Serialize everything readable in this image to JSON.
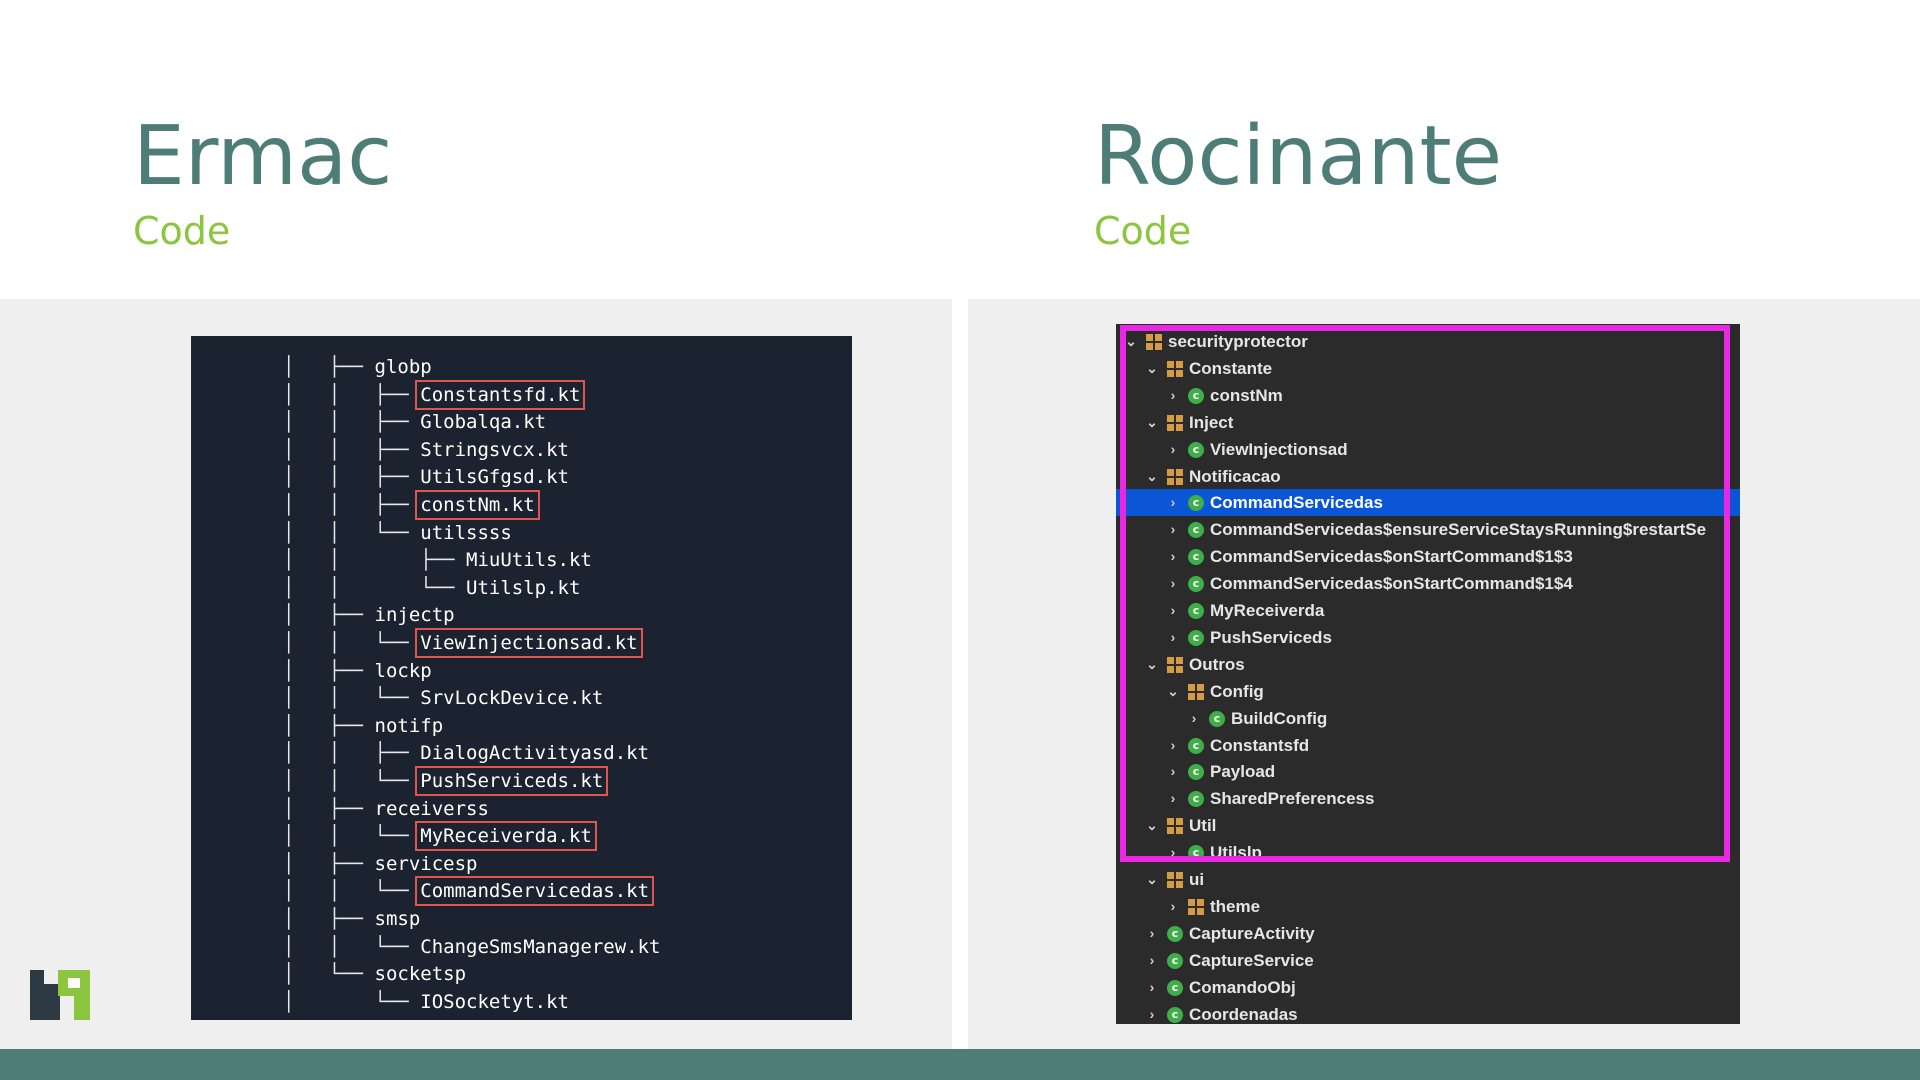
{
  "left": {
    "title": "Ermac",
    "subtitle": "Code"
  },
  "right": {
    "title": "Rocinante",
    "subtitle": "Code"
  },
  "colors": {
    "title": "#4e7d78",
    "subtitle": "#8cc63f",
    "highlight_box": "#ea28e4",
    "file_box": "#e0554d",
    "selected_row": "#0b56d4"
  },
  "ermac_tree": [
    {
      "prefix": "│   ├── ",
      "name": "globp",
      "boxed": false
    },
    {
      "prefix": "│   │   ├── ",
      "name": "Constantsfd.kt",
      "boxed": true
    },
    {
      "prefix": "│   │   ├── ",
      "name": "Globalqa.kt",
      "boxed": false
    },
    {
      "prefix": "│   │   ├── ",
      "name": "Stringsvcx.kt",
      "boxed": false
    },
    {
      "prefix": "│   │   ├── ",
      "name": "UtilsGfgsd.kt",
      "boxed": false
    },
    {
      "prefix": "│   │   ├── ",
      "name": "constNm.kt",
      "boxed": true
    },
    {
      "prefix": "│   │   └── ",
      "name": "utilssss",
      "boxed": false
    },
    {
      "prefix": "│   │       ├── ",
      "name": "MiuUtils.kt",
      "boxed": false
    },
    {
      "prefix": "│   │       └── ",
      "name": "Utilslp.kt",
      "boxed": false
    },
    {
      "prefix": "│   ├── ",
      "name": "injectp",
      "boxed": false
    },
    {
      "prefix": "│   │   └── ",
      "name": "ViewInjectionsad.kt",
      "boxed": true
    },
    {
      "prefix": "│   ├── ",
      "name": "lockp",
      "boxed": false
    },
    {
      "prefix": "│   │   └── ",
      "name": "SrvLockDevice.kt",
      "boxed": false
    },
    {
      "prefix": "│   ├── ",
      "name": "notifp",
      "boxed": false
    },
    {
      "prefix": "│   │   ├── ",
      "name": "DialogActivityasd.kt",
      "boxed": false
    },
    {
      "prefix": "│   │   └── ",
      "name": "PushServiceds.kt",
      "boxed": true
    },
    {
      "prefix": "│   ├── ",
      "name": "receiverss",
      "boxed": false
    },
    {
      "prefix": "│   │   └── ",
      "name": "MyReceiverda.kt",
      "boxed": true
    },
    {
      "prefix": "│   ├── ",
      "name": "servicesp",
      "boxed": false
    },
    {
      "prefix": "│   │   └── ",
      "name": "CommandServicedas.kt",
      "boxed": true
    },
    {
      "prefix": "│   ├── ",
      "name": "smsp",
      "boxed": false
    },
    {
      "prefix": "│   │   └── ",
      "name": "ChangeSmsManagerew.kt",
      "boxed": false
    },
    {
      "prefix": "│   └── ",
      "name": "socketsp",
      "boxed": false
    },
    {
      "prefix": "│       └── ",
      "name": "IOSocketyt.kt",
      "boxed": false
    }
  ],
  "rocinante_tree": [
    {
      "depth": 0,
      "chevron": "down",
      "icon": "package",
      "label": "securityprotector",
      "selected": false
    },
    {
      "depth": 1,
      "chevron": "down",
      "icon": "package",
      "label": "Constante",
      "selected": false
    },
    {
      "depth": 2,
      "chevron": "right",
      "icon": "class",
      "label": "constNm",
      "selected": false
    },
    {
      "depth": 1,
      "chevron": "down",
      "icon": "package",
      "label": "Inject",
      "selected": false
    },
    {
      "depth": 2,
      "chevron": "right",
      "icon": "class",
      "label": "ViewInjectionsad",
      "selected": false
    },
    {
      "depth": 1,
      "chevron": "down",
      "icon": "package",
      "label": "Notificacao",
      "selected": false
    },
    {
      "depth": 2,
      "chevron": "right",
      "icon": "class",
      "label": "CommandServicedas",
      "selected": true
    },
    {
      "depth": 2,
      "chevron": "right",
      "icon": "class",
      "label": "CommandServicedas$ensureServiceStaysRunning$restartSe",
      "selected": false
    },
    {
      "depth": 2,
      "chevron": "right",
      "icon": "class",
      "label": "CommandServicedas$onStartCommand$1$3",
      "selected": false
    },
    {
      "depth": 2,
      "chevron": "right",
      "icon": "class",
      "label": "CommandServicedas$onStartCommand$1$4",
      "selected": false
    },
    {
      "depth": 2,
      "chevron": "right",
      "icon": "class",
      "label": "MyReceiverda",
      "selected": false
    },
    {
      "depth": 2,
      "chevron": "right",
      "icon": "class",
      "label": "PushServiceds",
      "selected": false
    },
    {
      "depth": 1,
      "chevron": "down",
      "icon": "package",
      "label": "Outros",
      "selected": false
    },
    {
      "depth": 2,
      "chevron": "down",
      "icon": "package",
      "label": "Config",
      "selected": false
    },
    {
      "depth": 3,
      "chevron": "right",
      "icon": "class",
      "label": "BuildConfig",
      "selected": false
    },
    {
      "depth": 2,
      "chevron": "right",
      "icon": "class",
      "label": "Constantsfd",
      "selected": false
    },
    {
      "depth": 2,
      "chevron": "right",
      "icon": "class",
      "label": "Payload",
      "selected": false
    },
    {
      "depth": 2,
      "chevron": "right",
      "icon": "class",
      "label": "SharedPreferencess",
      "selected": false
    },
    {
      "depth": 1,
      "chevron": "down",
      "icon": "package",
      "label": "Util",
      "selected": false
    },
    {
      "depth": 2,
      "chevron": "right",
      "icon": "class",
      "label": "Utilslp",
      "selected": false
    },
    {
      "depth": 1,
      "chevron": "down",
      "icon": "package",
      "label": "ui",
      "selected": false
    },
    {
      "depth": 2,
      "chevron": "right",
      "icon": "package",
      "label": "theme",
      "selected": false
    },
    {
      "depth": 1,
      "chevron": "right",
      "icon": "class",
      "label": "CaptureActivity",
      "selected": false
    },
    {
      "depth": 1,
      "chevron": "right",
      "icon": "class",
      "label": "CaptureService",
      "selected": false
    },
    {
      "depth": 1,
      "chevron": "right",
      "icon": "class",
      "label": "ComandoObj",
      "selected": false
    },
    {
      "depth": 1,
      "chevron": "right",
      "icon": "class",
      "label": "Coordenadas",
      "selected": false
    }
  ]
}
